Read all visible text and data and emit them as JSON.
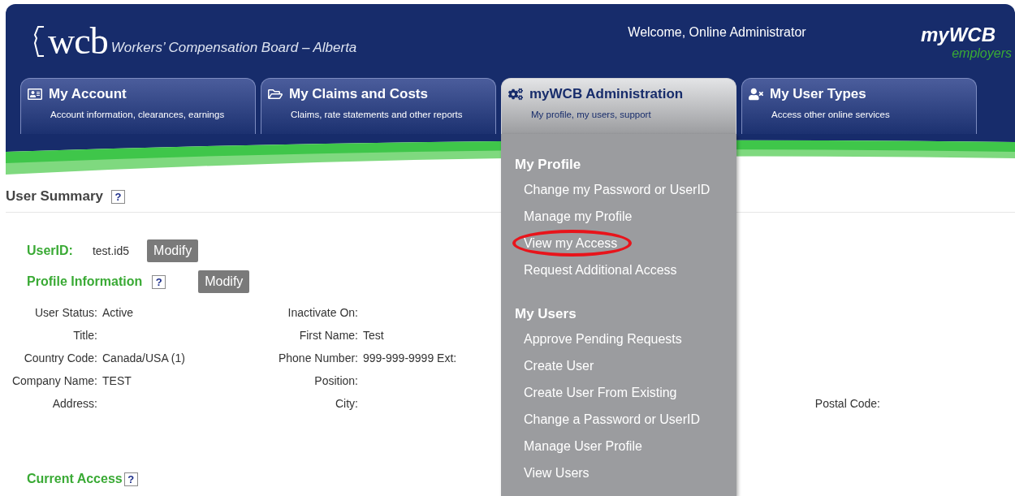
{
  "header": {
    "logo": "wcb",
    "org_name": "Workers’ Compensation Board – Alberta",
    "welcome": "Welcome, Online Administrator",
    "brand": "myWCB",
    "brand_sub": "employers"
  },
  "tabs": [
    {
      "kind": "card",
      "title": "My Account",
      "subtitle": "Account information, clearances, earnings",
      "selected": false
    },
    {
      "kind": "folder",
      "title": "My Claims and Costs",
      "subtitle": "Claims, rate statements and other reports",
      "selected": false
    },
    {
      "kind": "gears",
      "title": "myWCB Administration",
      "subtitle": "My profile, my users, support",
      "selected": true
    },
    {
      "kind": "user",
      "title": "My User Types",
      "subtitle": "Access other online services",
      "selected": false
    }
  ],
  "menu": {
    "sections": [
      {
        "heading": "My Profile",
        "items": [
          {
            "label": "Change my Password or UserID",
            "highlighted": false
          },
          {
            "label": "Manage my Profile",
            "highlighted": false
          },
          {
            "label": "View my Access",
            "highlighted": true
          },
          {
            "label": "Request Additional Access",
            "highlighted": false
          }
        ]
      },
      {
        "heading": "My Users",
        "items": [
          {
            "label": "Approve Pending Requests",
            "highlighted": false
          },
          {
            "label": "Create User",
            "highlighted": false
          },
          {
            "label": "Create User From Existing",
            "highlighted": false
          },
          {
            "label": "Change a Password or UserID",
            "highlighted": false
          },
          {
            "label": "Manage User Profile",
            "highlighted": false
          },
          {
            "label": "View Users",
            "highlighted": false
          }
        ]
      }
    ]
  },
  "summary": {
    "title": "User Summary",
    "help": "?",
    "userid_label": "UserID:",
    "userid": "test.id5",
    "userid_button": "Modify",
    "profile_heading": "Profile Information",
    "profile_help": "?",
    "profile_button": "Modify",
    "fields": [
      [
        {
          "label": "User Status:",
          "value": "Active"
        },
        {
          "label": "Inactivate On:"
        }
      ],
      [
        {
          "label": "Title:"
        },
        {
          "label": "First Name:",
          "value": "Test"
        }
      ],
      [
        {
          "label": "Country Code:",
          "value": "Canada/USA (1)"
        },
        {
          "label": "Phone Number:",
          "value": "999-999-9999 Ext:"
        }
      ],
      [
        {
          "label": "Company Name:",
          "value": "TEST"
        },
        {
          "label": "Position:"
        }
      ],
      [
        {
          "label": "Address:"
        },
        {
          "label": "City:"
        },
        {
          "label": "Postal Code:"
        }
      ]
    ],
    "access_heading": "Current Access",
    "access_help": "?"
  }
}
